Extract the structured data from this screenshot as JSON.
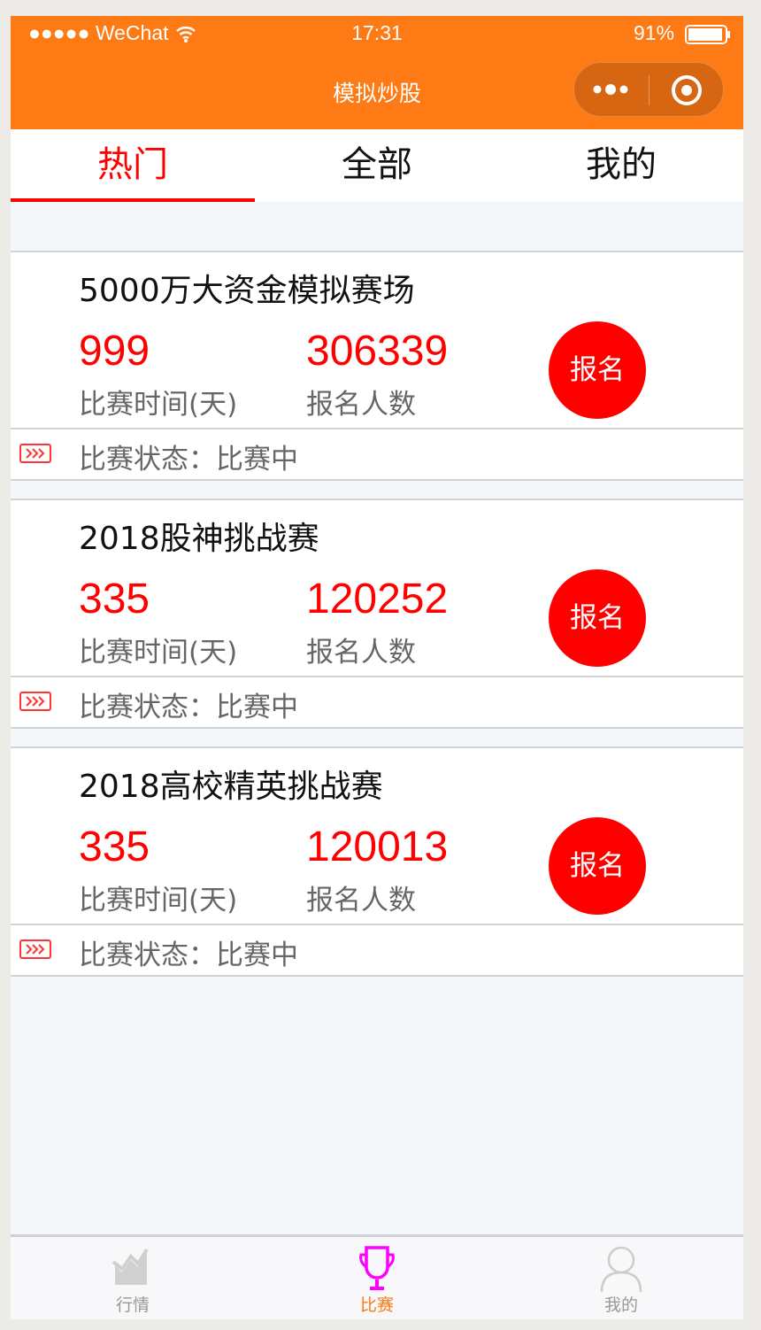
{
  "status_bar": {
    "signal": "●●●●● WeChat",
    "time": "17:31",
    "battery": "91%"
  },
  "nav": {
    "title": "模拟炒股"
  },
  "tabs": [
    {
      "label": "热门"
    },
    {
      "label": "全部"
    },
    {
      "label": "我的"
    }
  ],
  "cards": [
    {
      "title": "5000万大资金模拟赛场",
      "days": "999",
      "days_label": "比赛时间(天)",
      "count": "306339",
      "count_label": "报名人数",
      "button": "报名",
      "status": "比赛状态：比赛中"
    },
    {
      "title": "2018股神挑战赛",
      "days": "335",
      "days_label": "比赛时间(天)",
      "count": "120252",
      "count_label": "报名人数",
      "button": "报名",
      "status": "比赛状态：比赛中"
    },
    {
      "title": "2018高校精英挑战赛",
      "days": "335",
      "days_label": "比赛时间(天)",
      "count": "120013",
      "count_label": "报名人数",
      "button": "报名",
      "status": "比赛状态：比赛中"
    }
  ],
  "tabbar": [
    {
      "label": "行情",
      "icon": "chart-icon"
    },
    {
      "label": "比赛",
      "icon": "trophy-icon",
      "active": true
    },
    {
      "label": "我的",
      "icon": "user-icon"
    }
  ],
  "colors": {
    "nav": "#fd7a14",
    "accent": "#ff0000",
    "tab_active": "#ff00ff"
  }
}
